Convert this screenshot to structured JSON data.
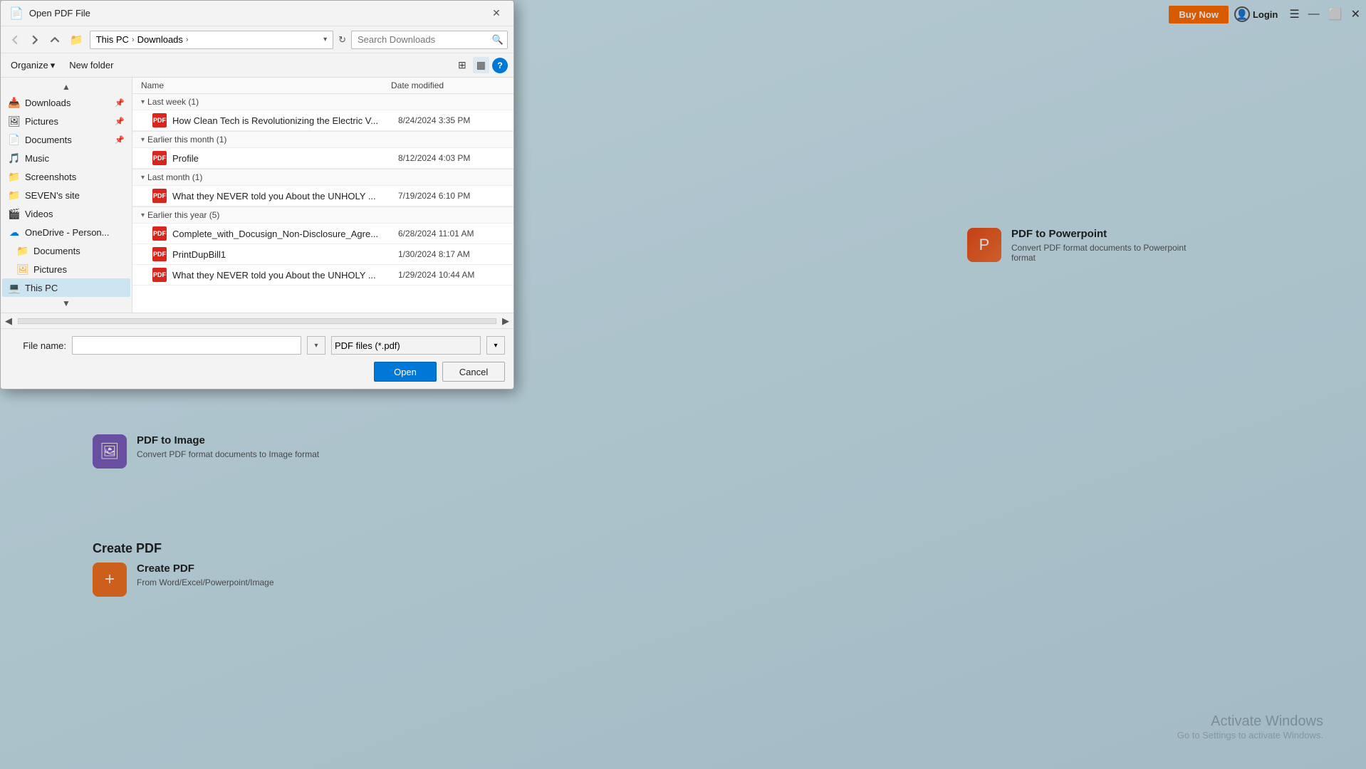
{
  "app": {
    "bg_color": "#c8e6f0"
  },
  "topbar": {
    "buy_now_label": "Buy Now",
    "login_label": "Login"
  },
  "bg_content": {
    "create_pdf_title": "Create PDF",
    "create_pdf_subtitle": "Create PDF",
    "create_pdf_description": "From Word/Excel/Powerpoint/Image",
    "pdf_to_image_title": "PDF to Image",
    "pdf_to_image_description": "Convert PDF format documents to Image format",
    "pdf_to_ppt_title": "PDF to Powerpoint",
    "pdf_to_ppt_description": "Convert PDF format documents to Powerpoint format"
  },
  "activate_windows": {
    "title": "Activate Windows",
    "subtitle": "Go to Settings to activate Windows."
  },
  "dialog": {
    "title": "Open PDF File",
    "search_placeholder": "Search Downloads",
    "breadcrumbs": [
      "This PC",
      "Downloads"
    ],
    "organize_label": "Organize",
    "new_folder_label": "New folder",
    "filename_label": "File name:",
    "filetype_label": "PDF files (*.pdf)",
    "open_label": "Open",
    "cancel_label": "Cancel",
    "columns": {
      "name": "Name",
      "date_modified": "Date modified"
    },
    "groups": [
      {
        "label": "Last week (1)",
        "files": [
          {
            "name": "How Clean Tech is Revolutionizing the Electric V...",
            "date": "8/24/2024 3:35 PM"
          }
        ]
      },
      {
        "label": "Earlier this month (1)",
        "files": [
          {
            "name": "Profile",
            "date": "8/12/2024 4:03 PM"
          }
        ]
      },
      {
        "label": "Last month (1)",
        "files": [
          {
            "name": "What they NEVER told you About the UNHOLY ...",
            "date": "7/19/2024 6:10 PM"
          }
        ]
      },
      {
        "label": "Earlier this year (5)",
        "files": [
          {
            "name": "Complete_with_Docusign_Non-Disclosure_Agre...",
            "date": "6/28/2024 11:01 AM"
          },
          {
            "name": "PrintDupBill1",
            "date": "1/30/2024 8:17 AM"
          },
          {
            "name": "What they NEVER told you About the UNHOLY ...",
            "date": "1/29/2024 10:44 AM"
          }
        ]
      }
    ],
    "sidebar": {
      "items": [
        {
          "label": "Downloads",
          "icon": "📥",
          "pinned": true,
          "type": "quickaccess"
        },
        {
          "label": "Pictures",
          "icon": "🖼",
          "pinned": true,
          "type": "quickaccess"
        },
        {
          "label": "Documents",
          "icon": "📄",
          "pinned": true,
          "type": "quickaccess"
        },
        {
          "label": "Music",
          "icon": "🎵",
          "pinned": false,
          "type": "quickaccess"
        },
        {
          "label": "Screenshots",
          "icon": "📁",
          "pinned": false,
          "type": "folder"
        },
        {
          "label": "SEVEN's site",
          "icon": "📁",
          "pinned": false,
          "type": "folder"
        },
        {
          "label": "Videos",
          "icon": "🎬",
          "pinned": false,
          "type": "quickaccess"
        },
        {
          "label": "OneDrive - Person...",
          "icon": "☁",
          "pinned": false,
          "type": "onedrive"
        },
        {
          "label": "Documents",
          "icon": "📁",
          "pinned": false,
          "type": "folder"
        },
        {
          "label": "Pictures",
          "icon": "🖼",
          "pinned": false,
          "type": "folder"
        },
        {
          "label": "This PC",
          "icon": "💻",
          "pinned": false,
          "type": "thispc"
        }
      ]
    }
  }
}
